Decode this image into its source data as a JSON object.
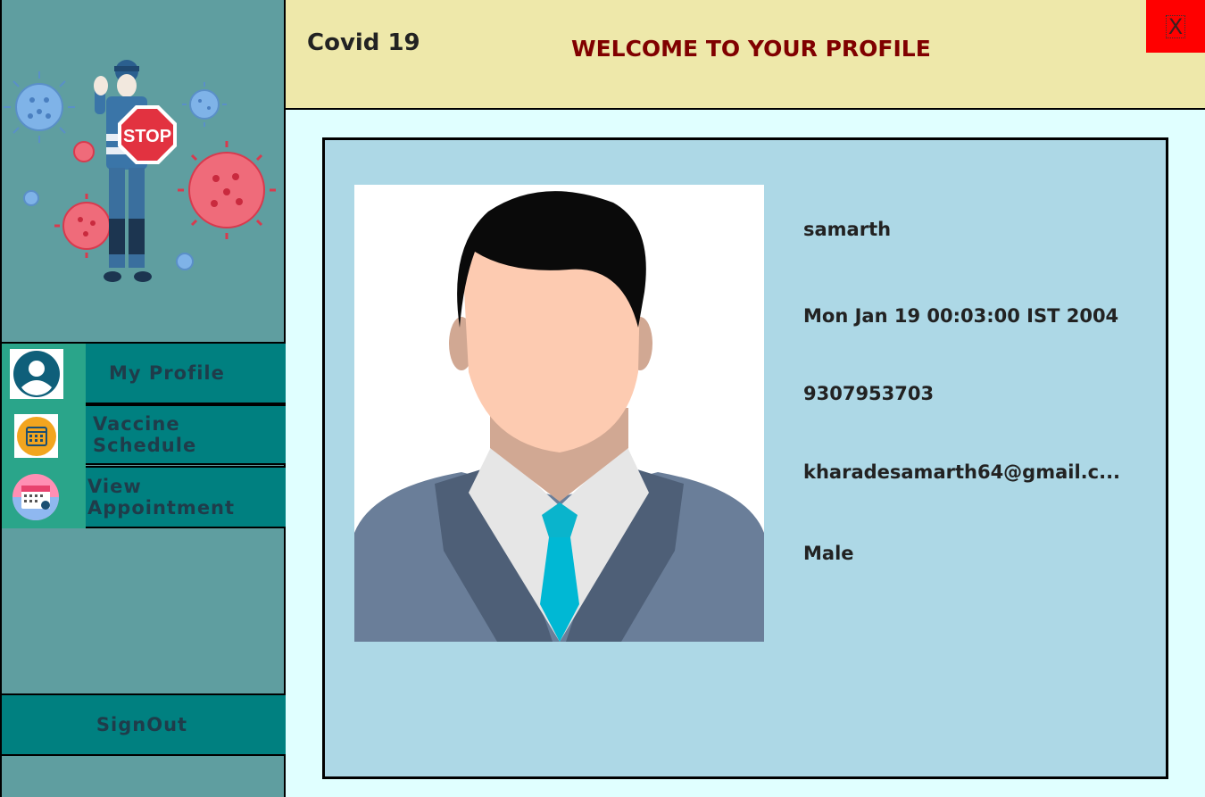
{
  "header": {
    "app_name": "Covid 19",
    "welcome": "WELCOME TO YOUR PROFILE",
    "close_label": "X"
  },
  "sidebar": {
    "items": [
      {
        "label": "My Profile",
        "icon": "user-icon"
      },
      {
        "label": "Vaccine Schedule",
        "icon": "calendar-icon"
      },
      {
        "label": "View Appointment",
        "icon": "appointment-calendar-icon"
      }
    ],
    "signout_label": "SignOut",
    "illustration": "covid-stop-illustration",
    "illustration_text": "STOP"
  },
  "profile": {
    "name": "samarth",
    "dob": "Mon Jan 19 00:03:00 IST 2004",
    "phone": "9307953703",
    "email": "kharadesamarth64@gmail.c...",
    "gender": "Male",
    "photo": "user-avatar-icon"
  },
  "colors": {
    "sidebar_bg": "#5f9ea0",
    "nav_bg": "#008080",
    "header_bg": "#eee8aa",
    "welcome_text": "#800000",
    "card_bg": "#add8e6",
    "main_bg": "#e0ffff",
    "close_bg": "#ff0000"
  }
}
